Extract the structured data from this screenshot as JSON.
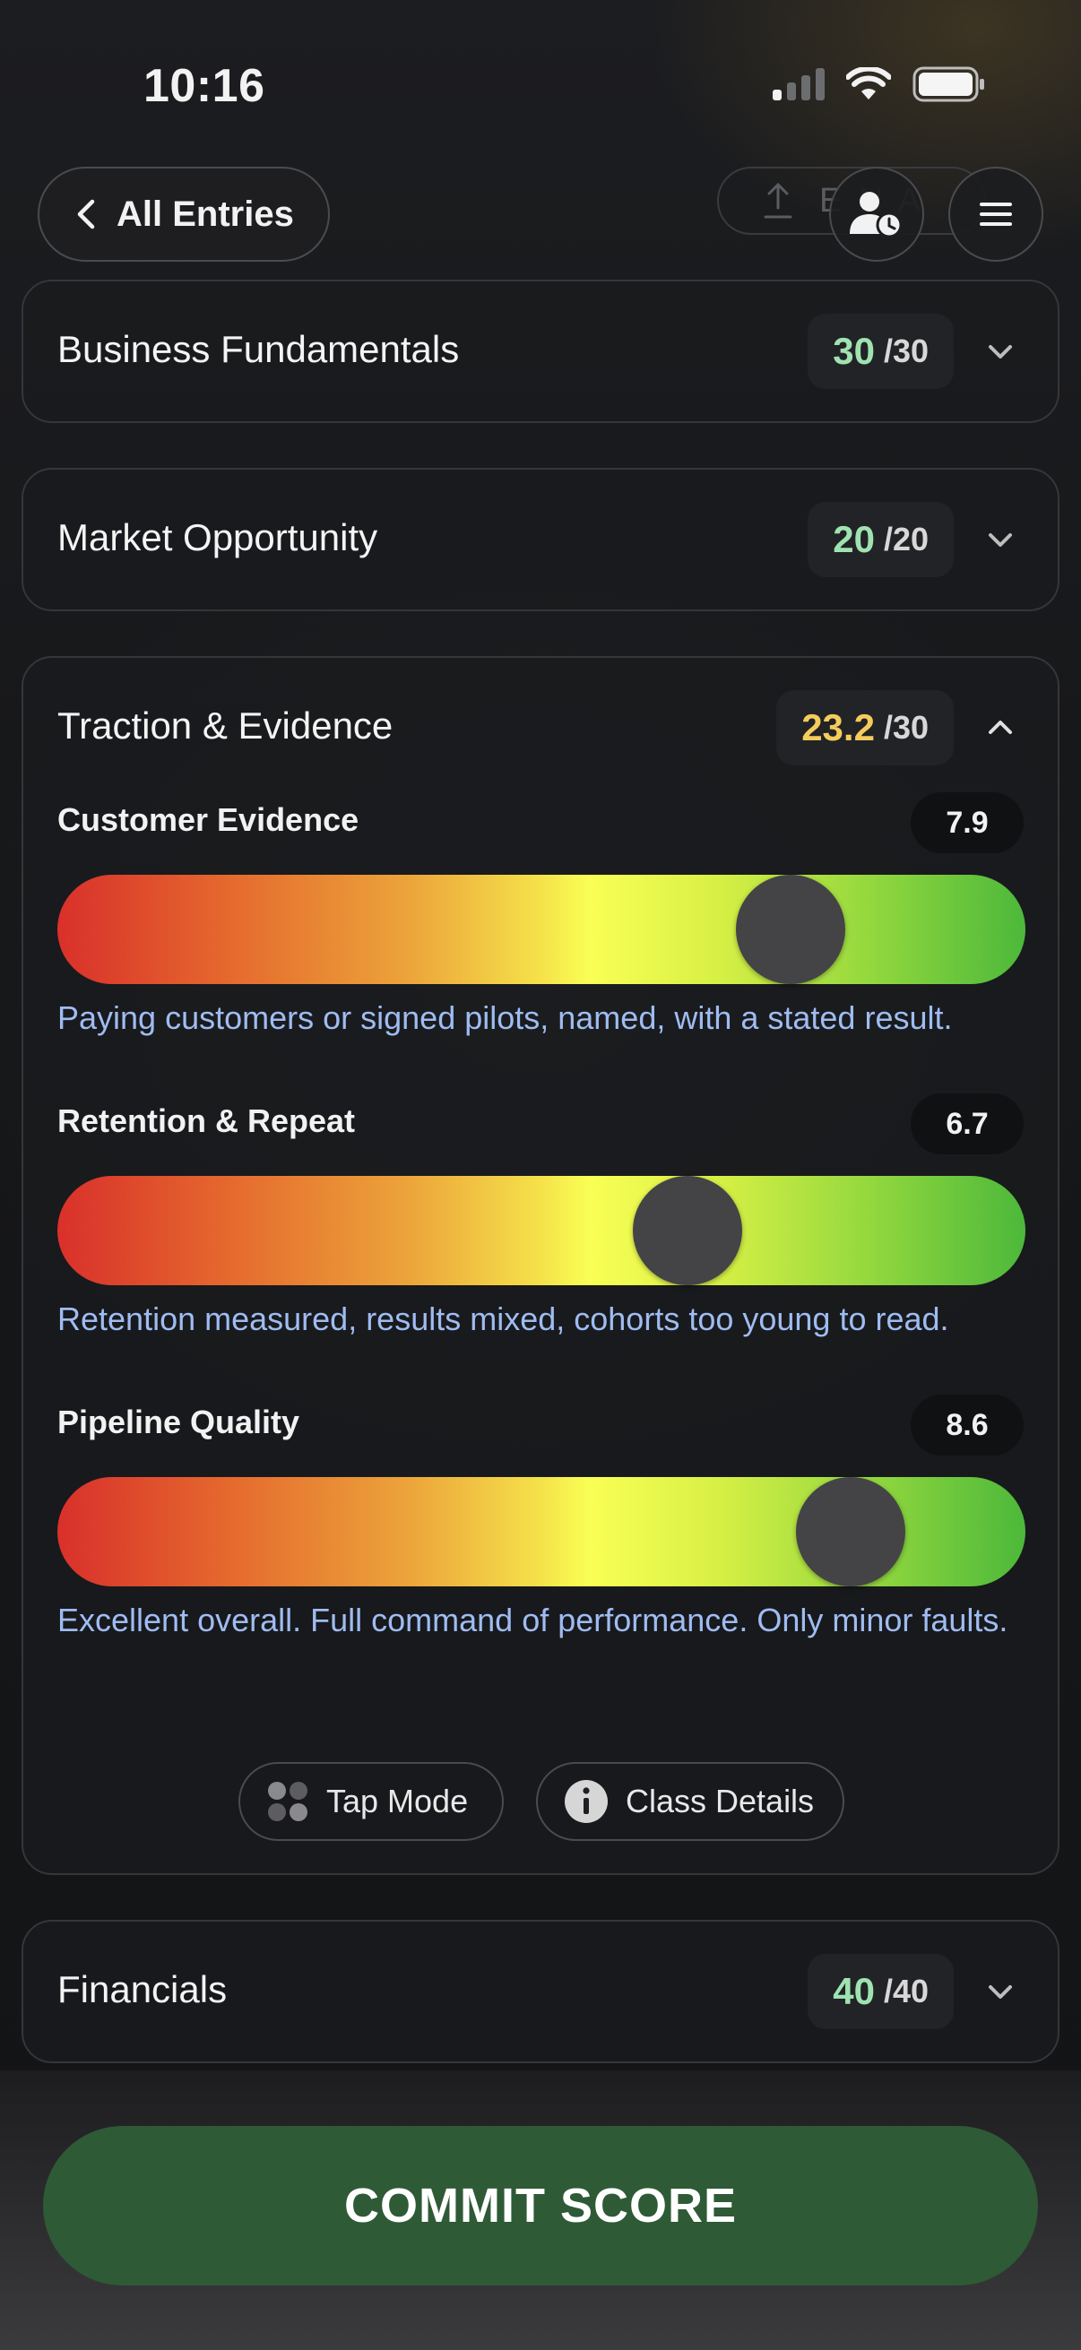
{
  "status": {
    "time": "10:16"
  },
  "nav": {
    "back_label": "All Entries",
    "ghost_label": "E   N  A"
  },
  "colors": {
    "score_green": "#9fe3b1",
    "score_yellow": "#f5cc5c",
    "description_blue": "#9fbcf2",
    "commit_green": "#2e5a36"
  },
  "sections": [
    {
      "title": "Business Fundamentals",
      "score": "30",
      "max": "/30",
      "expanded": false
    },
    {
      "title": "Market Opportunity",
      "score": "20",
      "max": "/20",
      "expanded": false
    },
    {
      "title": "Traction & Evidence",
      "score": "23.2",
      "max": "/30",
      "expanded": true
    },
    {
      "title": "Financials",
      "score": "40",
      "max": "/40",
      "expanded": false
    }
  ],
  "criteria": [
    {
      "label": "Customer Evidence",
      "value": "7.9",
      "level": 7.9,
      "description": "Paying customers or signed pilots, named, with a stated result."
    },
    {
      "label": "Retention & Repeat",
      "value": "6.7",
      "level": 6.7,
      "description": "Retention measured, results mixed, cohorts too young to read."
    },
    {
      "label": "Pipeline Quality",
      "value": "8.6",
      "level": 8.6,
      "description": "Excellent overall. Full command of performance. Only minor faults."
    }
  ],
  "actions": {
    "tap_mode": "Tap Mode",
    "class_details": "Class Details",
    "commit": "COMMIT SCORE"
  },
  "icons": {
    "back": "chevron-left-icon",
    "history": "user-clock-icon",
    "menu": "hamburger-icon",
    "tap_mode": "dots-grid-icon",
    "class_details": "info-icon"
  }
}
